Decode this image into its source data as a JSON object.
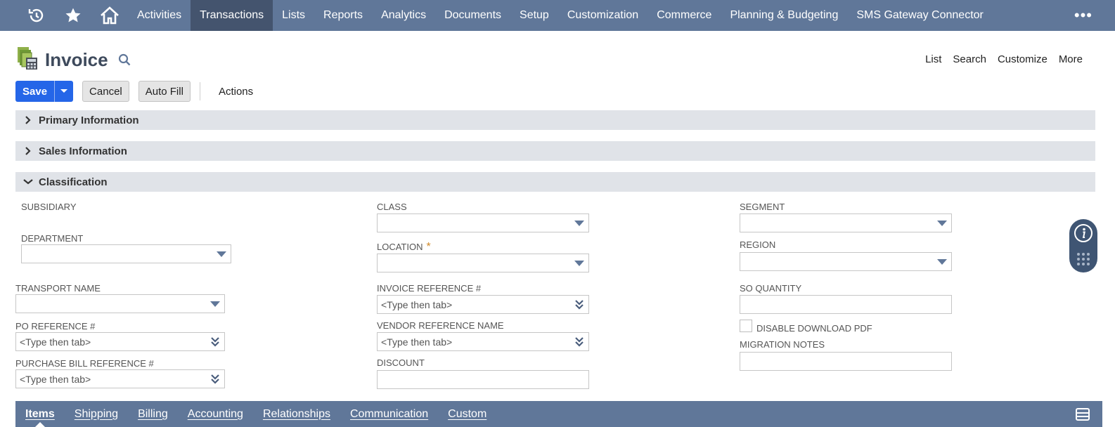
{
  "nav": {
    "icons": [
      "recent-icon",
      "star-icon",
      "home-icon"
    ],
    "items": [
      "Activities",
      "Transactions",
      "Lists",
      "Reports",
      "Analytics",
      "Documents",
      "Setup",
      "Customization",
      "Commerce",
      "Planning & Budgeting",
      "SMS Gateway Connector"
    ],
    "active": "Transactions",
    "more": "•••"
  },
  "page": {
    "title": "Invoice",
    "right_links": [
      "List",
      "Search",
      "Customize",
      "More"
    ]
  },
  "buttons": {
    "save": "Save",
    "cancel": "Cancel",
    "autofill": "Auto Fill",
    "actions": "Actions"
  },
  "sections": {
    "primary": "Primary Information",
    "sales": "Sales Information",
    "classification": "Classification"
  },
  "fields": {
    "subsidiary": {
      "label": "SUBSIDIARY"
    },
    "department": {
      "label": "DEPARTMENT",
      "value": ""
    },
    "transport_name": {
      "label": "TRANSPORT NAME",
      "value": ""
    },
    "po_reference": {
      "label": "PO REFERENCE #",
      "value": "<Type then tab>"
    },
    "purchase_bill_reference": {
      "label": "PURCHASE BILL REFERENCE #",
      "value": "<Type then tab>"
    },
    "class": {
      "label": "CLASS",
      "value": ""
    },
    "location": {
      "label": "LOCATION",
      "required": "*",
      "value": ""
    },
    "invoice_reference": {
      "label": "INVOICE REFERENCE #",
      "value": "<Type then tab>"
    },
    "vendor_reference_name": {
      "label": "VENDOR REFERENCE NAME",
      "value": "<Type then tab>"
    },
    "discount": {
      "label": "DISCOUNT",
      "value": ""
    },
    "segment": {
      "label": "SEGMENT",
      "value": ""
    },
    "region": {
      "label": "REGION",
      "value": ""
    },
    "so_quantity": {
      "label": "SO QUANTITY",
      "value": ""
    },
    "disable_download_pdf": {
      "label": "DISABLE DOWNLOAD PDF",
      "checked": false
    },
    "migration_notes": {
      "label": "MIGRATION NOTES",
      "value": ""
    }
  },
  "tabs": {
    "items": [
      "Items",
      "Shipping",
      "Billing",
      "Accounting",
      "Relationships",
      "Communication",
      "Custom"
    ],
    "active": "Items"
  },
  "colors": {
    "nav_bg": "#607799",
    "nav_active": "#44546e",
    "save_blue": "#2566e8",
    "section_bg": "#e0e3e8",
    "side_widget": "#3f5573"
  }
}
